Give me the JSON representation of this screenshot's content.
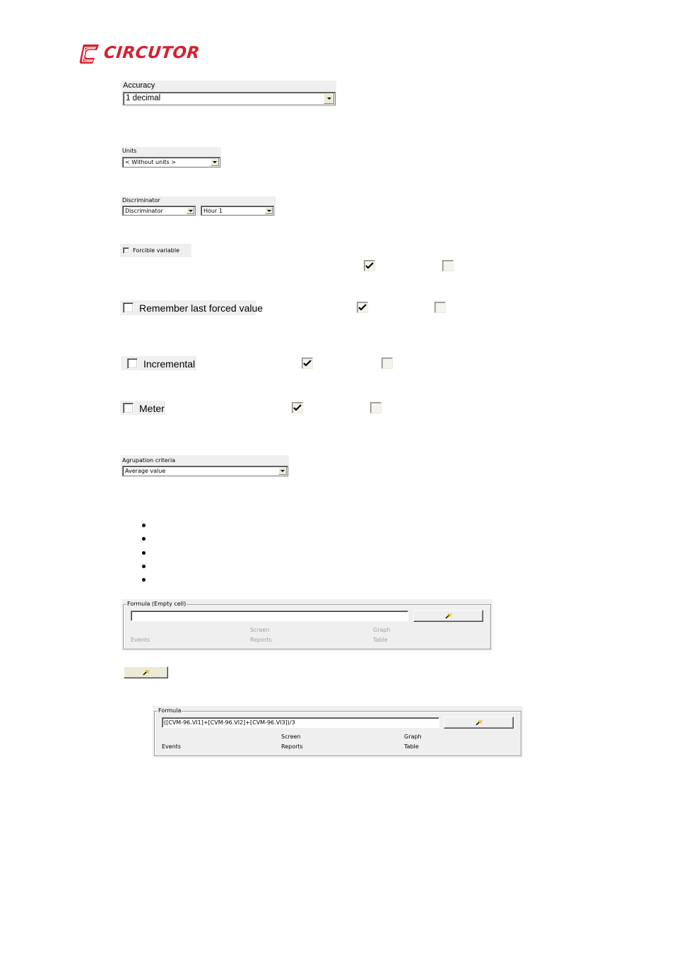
{
  "brand": {
    "name": "CIRCUTOR",
    "logo_icon": "circutor-c-logo-icon",
    "color": "#d4202f"
  },
  "accuracy": {
    "label": "Accuracy",
    "selected": "1 decimal"
  },
  "units": {
    "label": "Units",
    "selected": "< Without units >"
  },
  "discriminator": {
    "label": "Discriminator",
    "selected_type": "Discriminator",
    "selected_period": "Hour 1"
  },
  "forcible_variable": {
    "label": "Forcible variable",
    "checked": false,
    "legend_checked": true,
    "legend_unchecked": false
  },
  "remember_last_forced": {
    "label": "Remember last forced value",
    "checked": false,
    "legend_checked": true,
    "legend_unchecked": false
  },
  "incremental": {
    "label": "Incremental",
    "checked": false,
    "legend_checked": true,
    "legend_unchecked": false
  },
  "meter": {
    "label": "Meter",
    "checked": false,
    "legend_checked": true,
    "legend_unchecked": false
  },
  "agrupation": {
    "label": "Agrupation criteria",
    "selected": "Average value"
  },
  "bullets_count": 5,
  "formula_empty": {
    "legend": "Formula (Empty cell)",
    "value": "",
    "button_icon": "formula-wizard-icon",
    "tags": {
      "screen": "Screen",
      "graph": "Graph",
      "events": "Events",
      "reports": "Reports",
      "table": "Table"
    }
  },
  "standalone_button": {
    "icon": "formula-wizard-icon"
  },
  "formula_filled": {
    "legend": "Formula",
    "value": "([CVM-96.VI1]+[CVM-96.VI2]+[CVM-96.VI3])/3",
    "button_icon": "formula-wizard-icon",
    "tags": {
      "screen": "Screen",
      "graph": "Graph",
      "events": "Events",
      "reports": "Reports",
      "table": "Table"
    }
  }
}
